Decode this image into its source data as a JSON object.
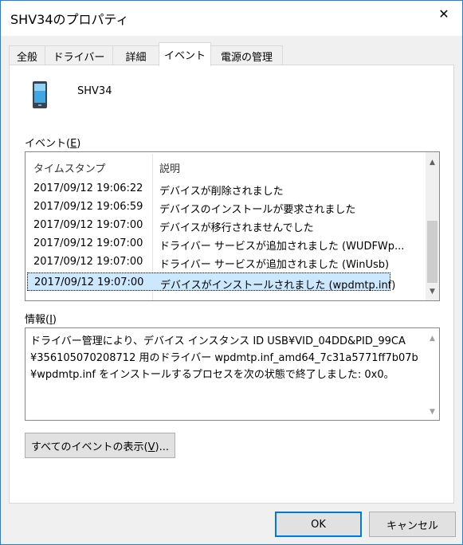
{
  "window": {
    "title": "SHV34のプロパティ",
    "close_glyph": "✕"
  },
  "tabs": [
    {
      "label": "全般"
    },
    {
      "label": "ドライバー"
    },
    {
      "label": "詳細"
    },
    {
      "label": "イベント"
    },
    {
      "label": "電源の管理"
    }
  ],
  "device": {
    "name": "SHV34",
    "icon": "mobile-device-icon"
  },
  "events": {
    "label": "イベント(E)",
    "columns": [
      "タイムスタンプ",
      "説明"
    ],
    "rows": [
      {
        "time": "2017/09/12 19:06:22",
        "desc": "デバイスが削除されました"
      },
      {
        "time": "2017/09/12 19:06:59",
        "desc": "デバイスのインストールが要求されました"
      },
      {
        "time": "2017/09/12 19:07:00",
        "desc": "デバイスが移行されませんでした"
      },
      {
        "time": "2017/09/12 19:07:00",
        "desc": "ドライバー サービスが追加されました (WUDFWp..."
      },
      {
        "time": "2017/09/12 19:07:00",
        "desc": "ドライバー サービスが追加されました (WinUsb)"
      },
      {
        "time": "2017/09/12 19:07:00",
        "desc": "デバイスがインストールされました (wpdmtp.inf)"
      }
    ]
  },
  "info": {
    "label": "情報(I)",
    "lines": [
      "ドライバー管理により、デバイス インスタンス ID USB¥VID_04DD&PID_99CA",
      "¥356105070208712 用のドライバー wpdmtp.inf_amd64_7c31a5771ff7b07b",
      "¥wpdmtp.inf をインストールするプロセスを次の状態で終了しました: 0x0。"
    ]
  },
  "buttons": {
    "all_events": "すべてのイベントの表示(V)...",
    "ok": "OK",
    "cancel": "キャンセル"
  },
  "colors": {
    "accent": "#0078d7",
    "selection": "#cce8ff"
  }
}
